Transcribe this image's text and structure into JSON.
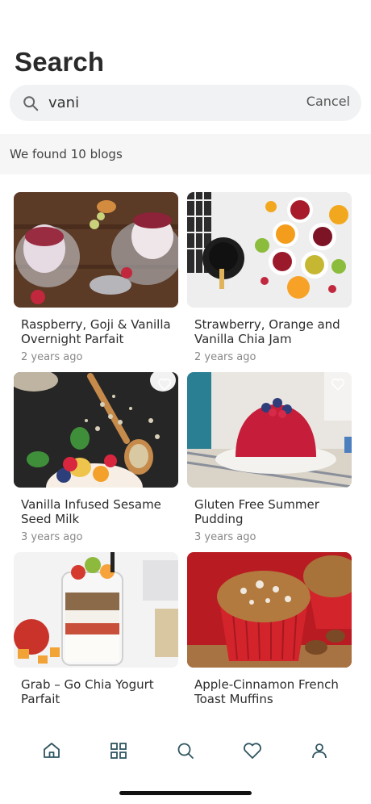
{
  "header": {
    "title": "Search"
  },
  "search": {
    "value": "vani",
    "cancel_label": "Cancel",
    "icon": "search-icon"
  },
  "results": {
    "summary": "We found 10 blogs"
  },
  "cards": [
    {
      "title": "Raspberry, Goji & Vanilla Overnight Parfait",
      "date": "2 years ago"
    },
    {
      "title": "Strawberry, Orange and Vanilla Chia Jam",
      "date": "2 years ago"
    },
    {
      "title": "Vanilla Infused Sesame Seed Milk",
      "date": "3 years ago"
    },
    {
      "title": "Gluten Free Summer Pudding",
      "date": "3 years ago"
    },
    {
      "title": "Grab – Go Chia Yogurt Parfait",
      "date": ""
    },
    {
      "title": "Apple-Cinnamon French Toast Muffins",
      "date": ""
    }
  ],
  "tabs": [
    {
      "icon": "home-icon"
    },
    {
      "icon": "grid-icon"
    },
    {
      "icon": "search-icon",
      "active": true
    },
    {
      "icon": "heart-icon"
    },
    {
      "icon": "profile-icon"
    }
  ],
  "colors": {
    "accent": "#3aa5a0",
    "title": "#2a2a2a",
    "meta": "#888888"
  }
}
